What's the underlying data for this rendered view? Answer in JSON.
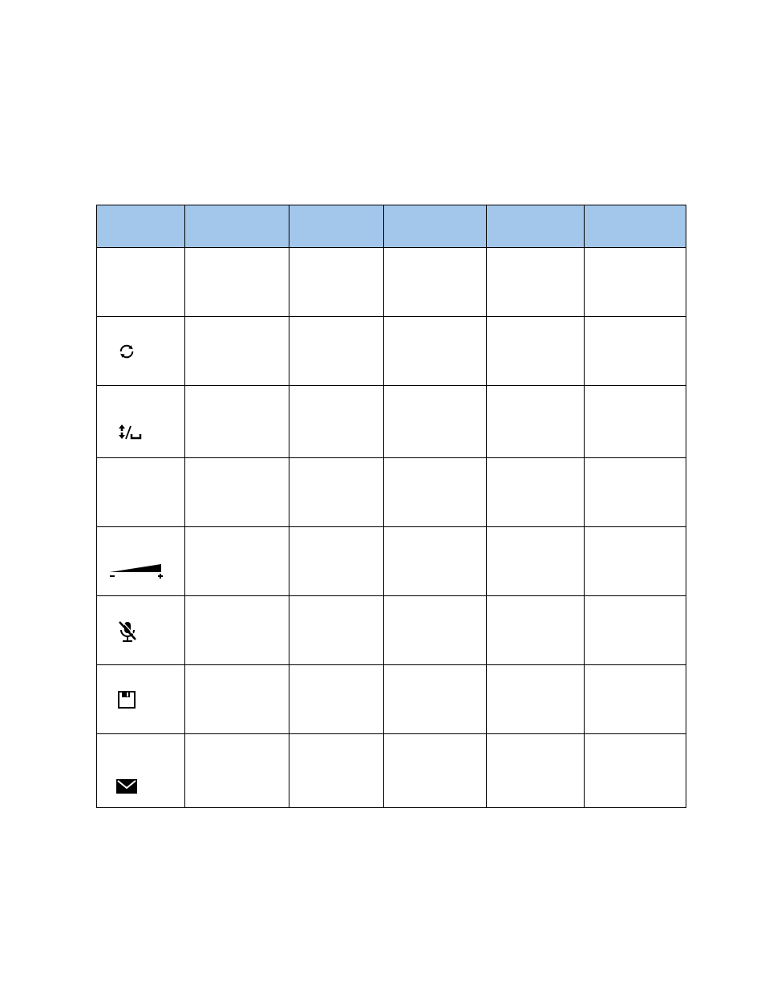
{
  "table": {
    "header_bg": "#a3c7eb",
    "columns": [
      "",
      "",
      "",
      "",
      "",
      ""
    ],
    "rows": [
      {
        "icon": null
      },
      {
        "icon": "sync-icon"
      },
      {
        "icon": "line-spacing-icon"
      },
      {
        "icon": null
      },
      {
        "icon": "volume-slider-icon"
      },
      {
        "icon": "mic-muted-icon"
      },
      {
        "icon": "save-icon"
      },
      {
        "icon": "mail-icon"
      }
    ]
  }
}
